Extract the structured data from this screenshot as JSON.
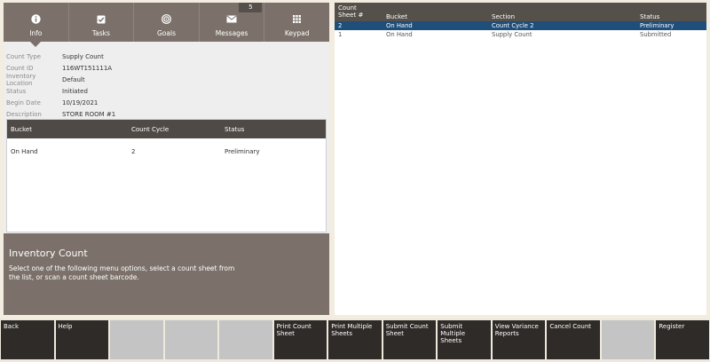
{
  "tabs": [
    {
      "label": "Info",
      "icon": "info-icon"
    },
    {
      "label": "Tasks",
      "icon": "tasks-icon"
    },
    {
      "label": "Goals",
      "icon": "goals-icon"
    },
    {
      "label": "Messages",
      "icon": "envelope-icon"
    },
    {
      "label": "Keypad",
      "icon": "keypad-icon"
    }
  ],
  "message_count": "5",
  "info": [
    {
      "label": "Count Type",
      "value": "Supply Count"
    },
    {
      "label": "Count ID",
      "value": "116WT151111A"
    },
    {
      "label": "Inventory Location",
      "value": "Default"
    },
    {
      "label": "Status",
      "value": "Initiated"
    },
    {
      "label": "Begin Date",
      "value": "10/19/2021"
    },
    {
      "label": "Description",
      "value": "STORE ROOM #1"
    }
  ],
  "bucket_table": {
    "headers": [
      "Bucket",
      "Count Cycle",
      "Status"
    ],
    "rows": [
      [
        "On Hand",
        "2",
        "Preliminary"
      ]
    ]
  },
  "prompt": {
    "title": "Inventory Count",
    "text": "Select one of the following menu options, select a count sheet from the list, or scan a count sheet barcode."
  },
  "sheets_table": {
    "headers": [
      "Count Sheet #",
      "Bucket",
      "Section",
      "Status"
    ],
    "rows": [
      [
        "2",
        "On Hand",
        "Count Cycle 2",
        "Preliminary"
      ],
      [
        "1",
        "On Hand",
        "Supply Count",
        "Submitted"
      ]
    ]
  },
  "footer": {
    "back": "Back",
    "help": "Help",
    "print_count_sheet": "Print Count Sheet",
    "print_multiple_sheets": "Print Multiple Sheets",
    "submit_count_sheet": "Submit Count Sheet",
    "submit_multiple_sheets": "Submit Multiple Sheets",
    "view_variance_reports": "View Variance Reports",
    "cancel_count": "Cancel Count",
    "register": "Register"
  },
  "colors": {
    "tab_bar": "#7b716a",
    "header_dark": "#504a47",
    "selected_row": "#1f4e7a",
    "footer_button": "#2f2b28",
    "background": "#f2ece1"
  }
}
